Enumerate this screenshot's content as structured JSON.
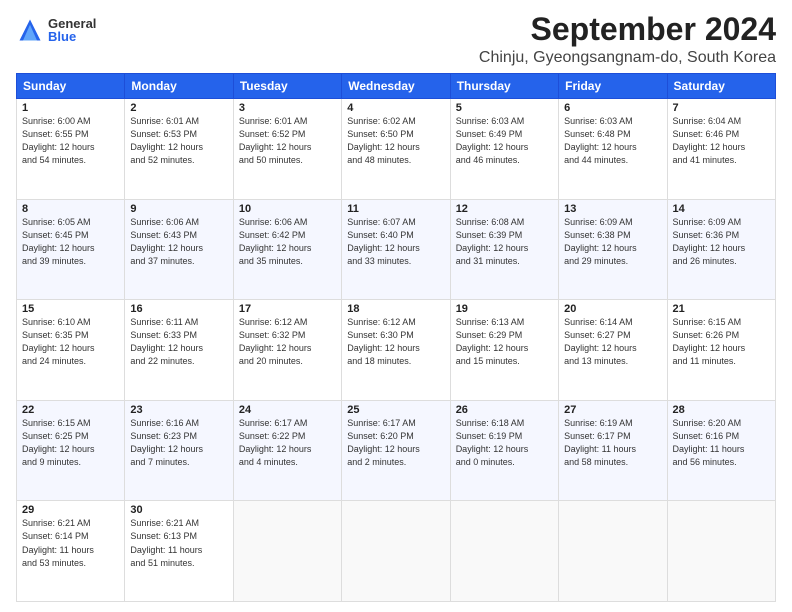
{
  "header": {
    "logo_general": "General",
    "logo_blue": "Blue",
    "title": "September 2024",
    "subtitle": "Chinju, Gyeongsangnam-do, South Korea"
  },
  "days": [
    "Sunday",
    "Monday",
    "Tuesday",
    "Wednesday",
    "Thursday",
    "Friday",
    "Saturday"
  ],
  "weeks": [
    [
      {
        "num": "1",
        "rise": "6:00 AM",
        "set": "6:55 PM",
        "hours": "12 hours",
        "mins": "54 minutes."
      },
      {
        "num": "2",
        "rise": "6:01 AM",
        "set": "6:53 PM",
        "hours": "12 hours",
        "mins": "52 minutes."
      },
      {
        "num": "3",
        "rise": "6:01 AM",
        "set": "6:52 PM",
        "hours": "12 hours",
        "mins": "50 minutes."
      },
      {
        "num": "4",
        "rise": "6:02 AM",
        "set": "6:50 PM",
        "hours": "12 hours",
        "mins": "48 minutes."
      },
      {
        "num": "5",
        "rise": "6:03 AM",
        "set": "6:49 PM",
        "hours": "12 hours",
        "mins": "46 minutes."
      },
      {
        "num": "6",
        "rise": "6:03 AM",
        "set": "6:48 PM",
        "hours": "12 hours",
        "mins": "44 minutes."
      },
      {
        "num": "7",
        "rise": "6:04 AM",
        "set": "6:46 PM",
        "hours": "12 hours",
        "mins": "41 minutes."
      }
    ],
    [
      {
        "num": "8",
        "rise": "6:05 AM",
        "set": "6:45 PM",
        "hours": "12 hours",
        "mins": "39 minutes."
      },
      {
        "num": "9",
        "rise": "6:06 AM",
        "set": "6:43 PM",
        "hours": "12 hours",
        "mins": "37 minutes."
      },
      {
        "num": "10",
        "rise": "6:06 AM",
        "set": "6:42 PM",
        "hours": "12 hours",
        "mins": "35 minutes."
      },
      {
        "num": "11",
        "rise": "6:07 AM",
        "set": "6:40 PM",
        "hours": "12 hours",
        "mins": "33 minutes."
      },
      {
        "num": "12",
        "rise": "6:08 AM",
        "set": "6:39 PM",
        "hours": "12 hours",
        "mins": "31 minutes."
      },
      {
        "num": "13",
        "rise": "6:09 AM",
        "set": "6:38 PM",
        "hours": "12 hours",
        "mins": "29 minutes."
      },
      {
        "num": "14",
        "rise": "6:09 AM",
        "set": "6:36 PM",
        "hours": "12 hours",
        "mins": "26 minutes."
      }
    ],
    [
      {
        "num": "15",
        "rise": "6:10 AM",
        "set": "6:35 PM",
        "hours": "12 hours",
        "mins": "24 minutes."
      },
      {
        "num": "16",
        "rise": "6:11 AM",
        "set": "6:33 PM",
        "hours": "12 hours",
        "mins": "22 minutes."
      },
      {
        "num": "17",
        "rise": "6:12 AM",
        "set": "6:32 PM",
        "hours": "12 hours",
        "mins": "20 minutes."
      },
      {
        "num": "18",
        "rise": "6:12 AM",
        "set": "6:30 PM",
        "hours": "12 hours",
        "mins": "18 minutes."
      },
      {
        "num": "19",
        "rise": "6:13 AM",
        "set": "6:29 PM",
        "hours": "12 hours",
        "mins": "15 minutes."
      },
      {
        "num": "20",
        "rise": "6:14 AM",
        "set": "6:27 PM",
        "hours": "12 hours",
        "mins": "13 minutes."
      },
      {
        "num": "21",
        "rise": "6:15 AM",
        "set": "6:26 PM",
        "hours": "12 hours",
        "mins": "11 minutes."
      }
    ],
    [
      {
        "num": "22",
        "rise": "6:15 AM",
        "set": "6:25 PM",
        "hours": "12 hours",
        "mins": "9 minutes."
      },
      {
        "num": "23",
        "rise": "6:16 AM",
        "set": "6:23 PM",
        "hours": "12 hours",
        "mins": "7 minutes."
      },
      {
        "num": "24",
        "rise": "6:17 AM",
        "set": "6:22 PM",
        "hours": "12 hours",
        "mins": "4 minutes."
      },
      {
        "num": "25",
        "rise": "6:17 AM",
        "set": "6:20 PM",
        "hours": "12 hours",
        "mins": "2 minutes."
      },
      {
        "num": "26",
        "rise": "6:18 AM",
        "set": "6:19 PM",
        "hours": "12 hours",
        "mins": "0 minutes."
      },
      {
        "num": "27",
        "rise": "6:19 AM",
        "set": "6:17 PM",
        "hours": "11 hours",
        "mins": "58 minutes."
      },
      {
        "num": "28",
        "rise": "6:20 AM",
        "set": "6:16 PM",
        "hours": "11 hours",
        "mins": "56 minutes."
      }
    ],
    [
      {
        "num": "29",
        "rise": "6:21 AM",
        "set": "6:14 PM",
        "hours": "11 hours",
        "mins": "53 minutes."
      },
      {
        "num": "30",
        "rise": "6:21 AM",
        "set": "6:13 PM",
        "hours": "11 hours",
        "mins": "51 minutes."
      },
      null,
      null,
      null,
      null,
      null
    ]
  ],
  "labels": {
    "sunrise": "Sunrise:",
    "sunset": "Sunset:",
    "daylight": "Daylight:"
  }
}
